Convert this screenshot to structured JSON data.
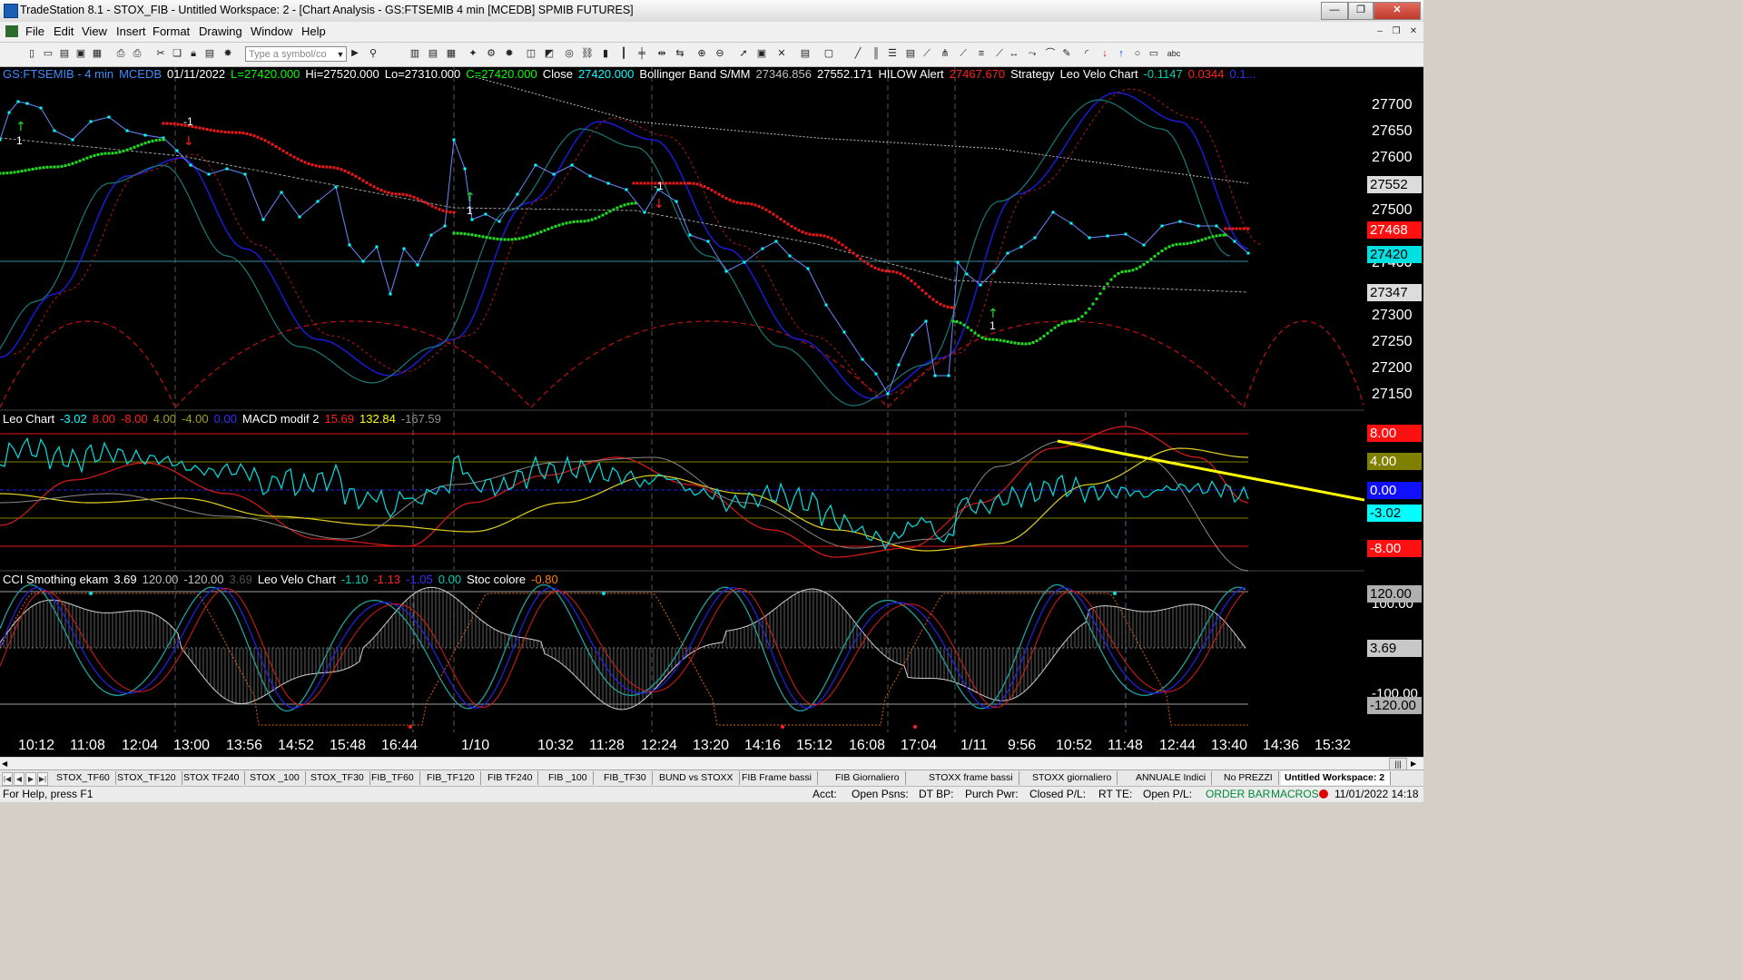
{
  "window": {
    "title": "TradeStation 8.1 - STOX_FIB - Untitled Workspace:  2 - [Chart Analysis - GS:FTSEMIB  4 min  [MCEDB] SPMIB FUTURES]",
    "minimize": "—",
    "restore": "❐",
    "close": "✕"
  },
  "menu": {
    "items": [
      "File",
      "Edit",
      "View",
      "Insert",
      "Format",
      "Drawing",
      "Window",
      "Help"
    ]
  },
  "toolbar": {
    "symbol_placeholder": "Type a symbol/co",
    "text_tool": "abc"
  },
  "chart": {
    "price_header": [
      {
        "text": "GS:FTSEMIB - 4 min",
        "color": "#3c8cff"
      },
      {
        "text": "MCEDB",
        "color": "#3c8cff"
      },
      {
        "text": "01/11/2022",
        "color": "#ffffff"
      },
      {
        "text": "L=27420.000",
        "color": "#00ff00"
      },
      {
        "text": "Hi=27520.000",
        "color": "#ffffff"
      },
      {
        "text": "Lo=27310.000",
        "color": "#ffffff"
      },
      {
        "text": "C=27420.000",
        "color": "#00ff00"
      },
      {
        "text": "Close",
        "color": "#ffffff"
      },
      {
        "text": "27420.000",
        "color": "#00ffff"
      },
      {
        "text": "Bollinger Band S/MM",
        "color": "#ffffff"
      },
      {
        "text": "27346.856",
        "color": "#c0c0c0"
      },
      {
        "text": "27552.171",
        "color": "#ffffff"
      },
      {
        "text": "HILOW Alert",
        "color": "#ffffff"
      },
      {
        "text": "27467.670",
        "color": "#ff2020"
      },
      {
        "text": "Strategy",
        "color": "#ffffff"
      },
      {
        "text": "Leo Velo Chart",
        "color": "#ffffff"
      },
      {
        "text": "-0.1147",
        "color": "#00d0b0"
      },
      {
        "text": "0.0344",
        "color": "#ff2020"
      },
      {
        "text": "0.1...",
        "color": "#3030ff"
      }
    ],
    "leo_header": [
      {
        "text": "Leo Chart",
        "color": "#ffffff"
      },
      {
        "text": "-3.02",
        "color": "#00ffff"
      },
      {
        "text": "8.00",
        "color": "#ff2020"
      },
      {
        "text": "-8.00",
        "color": "#ff2020"
      },
      {
        "text": "4.00",
        "color": "#a0a020"
      },
      {
        "text": "-4.00",
        "color": "#a0a020"
      },
      {
        "text": "0.00",
        "color": "#3030ff"
      },
      {
        "text": "MACD modif 2",
        "color": "#ffffff"
      },
      {
        "text": "15.69",
        "color": "#ff2020"
      },
      {
        "text": "132.84",
        "color": "#ffff00"
      },
      {
        "text": "-167.59",
        "color": "#909090"
      }
    ],
    "cci_header": [
      {
        "text": "CCI Smothing ekam",
        "color": "#ffffff"
      },
      {
        "text": "3.69",
        "color": "#ffffff"
      },
      {
        "text": "120.00",
        "color": "#c0c0c0"
      },
      {
        "text": "-120.00",
        "color": "#c0c0c0"
      },
      {
        "text": "3.69",
        "color": "#505050"
      },
      {
        "text": "Leo Velo Chart",
        "color": "#ffffff"
      },
      {
        "text": "-1.10",
        "color": "#00d0b0"
      },
      {
        "text": "-1.13",
        "color": "#ff2020"
      },
      {
        "text": "-1.05",
        "color": "#3030ff"
      },
      {
        "text": "0.00",
        "color": "#00d0b0"
      },
      {
        "text": "Stoc colore",
        "color": "#ffffff"
      },
      {
        "text": "-0.80",
        "color": "#ff8000"
      }
    ],
    "signal_labels": [
      "1",
      "-1",
      "1",
      "-1",
      "1"
    ],
    "price_ticks": [
      "27700",
      "27650",
      "27600",
      "27500",
      "27400",
      "27300",
      "27250",
      "27200",
      "27150"
    ],
    "price_boxes": [
      {
        "text": "27552",
        "bg": "#dcdcdc",
        "fg": "#000000"
      },
      {
        "text": "27468",
        "bg": "#ff1010",
        "fg": "#ffffff"
      },
      {
        "text": "27420",
        "bg": "#00e0e0",
        "fg": "#000000"
      },
      {
        "text": "27347",
        "bg": "#dcdcdc",
        "fg": "#000000"
      }
    ],
    "leo_boxes": [
      {
        "text": "8.00",
        "bg": "#ff1010",
        "fg": "#ffffff"
      },
      {
        "text": "4.00",
        "bg": "#808000",
        "fg": "#ffffff"
      },
      {
        "text": "0.00",
        "bg": "#1010ff",
        "fg": "#ffffff"
      },
      {
        "text": "-3.02",
        "bg": "#00ffff",
        "fg": "#000000"
      },
      {
        "text": "-8.00",
        "bg": "#ff1010",
        "fg": "#ffffff"
      }
    ],
    "cci_boxes": [
      {
        "text": "120.00",
        "bg": "#b0b0b0",
        "fg": "#000000"
      },
      {
        "text": "3.69",
        "bg": "#c8c8c8",
        "fg": "#000000"
      },
      {
        "text": "-120.00",
        "bg": "#b0b0b0",
        "fg": "#000000"
      }
    ],
    "partial_ticks": {
      "leo": "-4.00",
      "cci_top": "100.00",
      "cci_bottom": "-100.00"
    },
    "time_ticks": [
      "10:12",
      "11:08",
      "12:04",
      "13:00",
      "13:56",
      "14:52",
      "15:48",
      "16:44",
      "1/10",
      "10:32",
      "11:28",
      "12:24",
      "13:20",
      "14:16",
      "15:12",
      "16:08",
      "17:04",
      "1/11",
      "9:56",
      "10:52",
      "11:48",
      "12:44",
      "13:40",
      "14:36",
      "15:32"
    ]
  },
  "tabs": [
    "STOX_TF60",
    "STOX_TF120",
    "STOX TF240",
    "STOX _100",
    "STOX_TF30",
    "FIB_TF60",
    "FIB_TF120",
    "FIB TF240",
    "FIB _100",
    "FIB_TF30",
    "BUND vs STOXX",
    "FIB Frame bassi",
    "FIB Giornaliero",
    "STOXX frame bassi",
    "STOXX giornaliero",
    "ANNUALE Indici",
    "No PREZZI",
    "Untitled Workspace:  2"
  ],
  "status": {
    "help": "For Help, press F1",
    "acct": "Acct:",
    "open_psns": "Open Psns:",
    "dt_bp": "DT BP:",
    "purch_pwr": "Purch Pwr:",
    "closed_pl": "Closed P/L:",
    "rt_te": "RT TE:",
    "open_pl": "Open P/L:",
    "order_bar": "ORDER BAR",
    "macros": "MACROS",
    "datetime": "11/01/2022 14:18"
  }
}
